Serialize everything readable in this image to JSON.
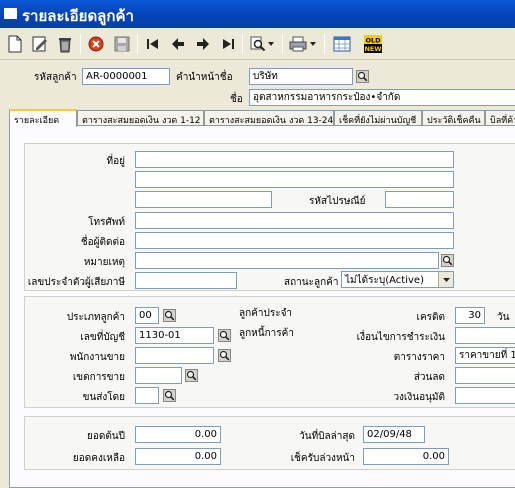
{
  "window": {
    "title": "รายละเอียดลูกค้า"
  },
  "toolbar": {
    "icons": [
      "new-document-icon",
      "edit-icon",
      "trash-icon",
      "cancel-icon",
      "save-icon",
      "first-record-icon",
      "previous-record-icon",
      "next-record-icon",
      "last-record-icon",
      "search-icon",
      "print-icon",
      "spreadsheet-icon",
      "old-new-icon"
    ],
    "old_new_top": "OLD",
    "old_new_bottom": "NEW"
  },
  "header": {
    "customer_code_label": "รหัสลูกค้า",
    "customer_code_value": "AR-0000001",
    "prefix_label": "คำนำหน้าชื่อ",
    "prefix_value": "บริษัท",
    "name_label": "ชื่อ",
    "name_value": "อุตสาหกรรมอาหารกระป๋อง•จำกัด"
  },
  "tabs": [
    "รายละเอียด",
    "ตารางสะสมยอดเงิน งวด 1-12",
    "ตารางสะสมยอดเงิน งวด 13-24",
    "เช็คที่ยังไม่ผ่านบัญชี",
    "ประวัติเช็คคืน",
    "บิลที่ค้า"
  ],
  "details": {
    "address_label": "ที่อยู่",
    "address_line1": "",
    "address_line2": "",
    "address_line3": "",
    "postal_code_label": "รหัสไปรษณีย์",
    "postal_code_value": "",
    "phone_label": "โทรศัพท์",
    "phone_value": "",
    "contact_label": "ชื่อผู้ติดต่อ",
    "contact_value": "",
    "note_label": "หมายเหตุ",
    "note_value": "",
    "tax_id_label": "เลขประจำตัวผู้เสียภาษี",
    "tax_id_value": "",
    "status_label": "สถานะลูกค้า",
    "status_value": "ไม่ได้ระบุ(Active)"
  },
  "account": {
    "customer_type_label": "ประเภทลูกค้า",
    "customer_type_value": "00",
    "regular_customer_label": "ลูกค้าประจำ",
    "account_no_label": "เลขที่บัญชี",
    "account_no_value": "1130-01",
    "trade_debtor_label": "ลูกหนี้การค้า",
    "salesperson_label": "พนักงานขาย",
    "salesperson_value": "",
    "sales_area_label": "เขตการขาย",
    "sales_area_value": "",
    "shipping_label": "ขนส่งโดย",
    "shipping_value": "",
    "credit_label": "เครดิต",
    "credit_value": "30",
    "credit_unit": "วัน",
    "payment_terms_label": "เงื่อนไขการชำระเงิน",
    "payment_terms_value": "",
    "price_table_label": "ตารางราคา",
    "price_table_value": "ราคาขายที่ 1",
    "discount_label": "ส่วนลด",
    "discount_value": "",
    "credit_limit_label": "วงเงินอนุมัติ",
    "credit_limit_value": ""
  },
  "balances": {
    "opening_balance_label": "ยอดต้นปี",
    "opening_balance_value": "0.00",
    "remaining_balance_label": "ยอดคงเหลือ",
    "remaining_balance_value": "0.00",
    "last_bill_date_label": "วันที่บิลล่าสุด",
    "last_bill_date_value": "02/09/48",
    "advance_cheque_label": "เช็ครับล่วงหน้า",
    "advance_cheque_value": "0.00"
  },
  "colors": {
    "titlebar": "#0543b8",
    "accent_tab": "#ffc83c",
    "field_border": "#7f9db9",
    "background": "#ece9d8"
  }
}
